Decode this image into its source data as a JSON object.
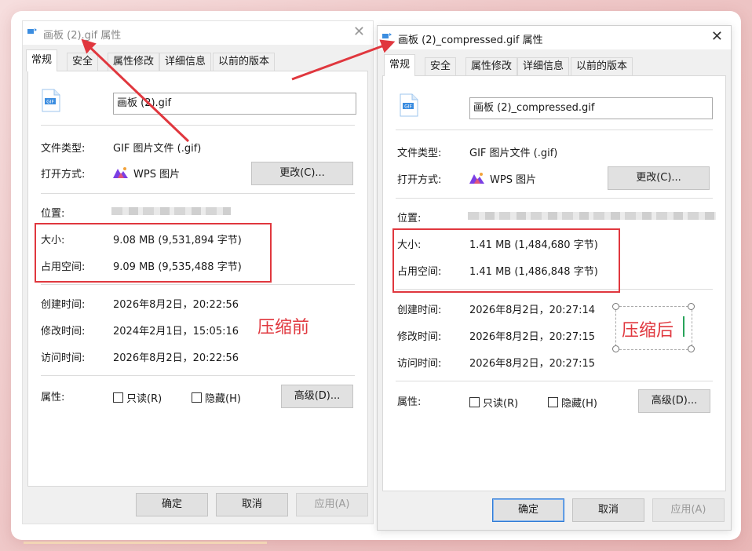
{
  "left_dialog": {
    "title": "画板 (2).gif 属性",
    "close": "✕",
    "tabs": [
      "常规",
      "安全",
      "属性修改",
      "详细信息",
      "以前的版本"
    ],
    "filename": "画板 (2).gif",
    "type_label": "文件类型:",
    "type_value": "GIF 图片文件 (.gif)",
    "open_label": "打开方式:",
    "open_value": "WPS 图片",
    "change_btn": "更改(C)...",
    "location_label": "位置:",
    "size_label": "大小:",
    "size_value": "9.08 MB (9,531,894 字节)",
    "disk_label": "占用空间:",
    "disk_value": "9.09 MB (9,535,488 字节)",
    "created_label": "创建时间:",
    "created_value": "2026年8月2日，20:22:56",
    "modified_label": "修改时间:",
    "modified_value": "2024年2月1日，15:05:16",
    "accessed_label": "访问时间:",
    "accessed_value": "2026年8月2日，20:22:56",
    "attr_label": "属性:",
    "readonly": "只读(R)",
    "hidden": "隐藏(H)",
    "advanced_btn": "高级(D)...",
    "ok_btn": "确定",
    "cancel_btn": "取消",
    "apply_btn": "应用(A)",
    "annotation": "压缩前"
  },
  "right_dialog": {
    "title": "画板 (2)_compressed.gif 属性",
    "close": "✕",
    "tabs": [
      "常规",
      "安全",
      "属性修改",
      "详细信息",
      "以前的版本"
    ],
    "filename": "画板 (2)_compressed.gif",
    "type_label": "文件类型:",
    "type_value": "GIF 图片文件 (.gif)",
    "open_label": "打开方式:",
    "open_value": "WPS 图片",
    "change_btn": "更改(C)...",
    "location_label": "位置:",
    "size_label": "大小:",
    "size_value": "1.41 MB (1,484,680 字节)",
    "disk_label": "占用空间:",
    "disk_value": "1.41 MB (1,486,848 字节)",
    "created_label": "创建时间:",
    "created_value": "2026年8月2日，20:27:14",
    "modified_label": "修改时间:",
    "modified_value": "2026年8月2日，20:27:15",
    "accessed_label": "访问时间:",
    "accessed_value": "2026年8月2日，20:27:15",
    "attr_label": "属性:",
    "readonly": "只读(R)",
    "hidden": "隐藏(H)",
    "advanced_btn": "高级(D)...",
    "ok_btn": "确定",
    "cancel_btn": "取消",
    "apply_btn": "应用(A)",
    "annotation": "压缩后"
  },
  "colors": {
    "annotation_red": "#e0373e",
    "gif_icon_blue": "#3b8de0",
    "wps_purple": "#7b3fe4",
    "primary_button_border": "#2f7bd6"
  },
  "icons": {
    "file": "gif-file-icon",
    "app": "wps-picture-icon",
    "close": "close-icon",
    "arrows": "red-arrow"
  }
}
